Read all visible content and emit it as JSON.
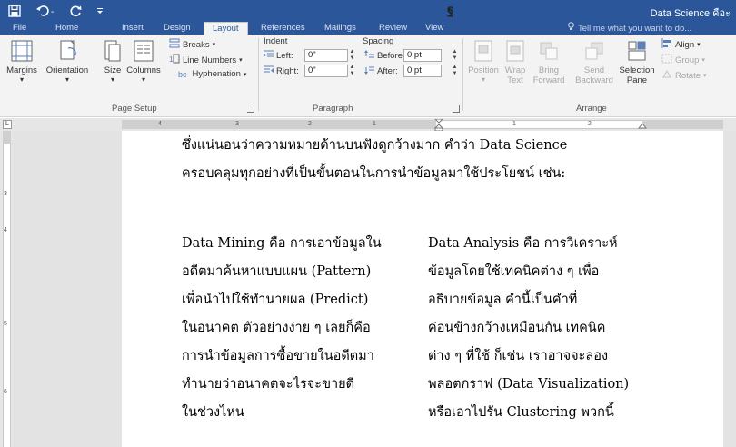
{
  "titlebar": {
    "doc_title": "Data Science คือะ",
    "title_mark": "ฐ"
  },
  "tabs": [
    {
      "label": "File"
    },
    {
      "label": "Home"
    },
    {
      "label": "Insert"
    },
    {
      "label": "Design"
    },
    {
      "label": "Layout"
    },
    {
      "label": "References"
    },
    {
      "label": "Mailings"
    },
    {
      "label": "Review"
    },
    {
      "label": "View"
    }
  ],
  "tell_me": "Tell me what you want to do...",
  "ribbon": {
    "page_setup": {
      "margins": "Margins",
      "orientation": "Orientation",
      "size": "Size",
      "columns": "Columns",
      "breaks": "Breaks",
      "line_numbers": "Line Numbers",
      "hyphenation": "Hyphenation",
      "group_label": "Page Setup"
    },
    "paragraph": {
      "indent_label": "Indent",
      "spacing_label": "Spacing",
      "left_label": "Left:",
      "left_value": "0\"",
      "right_label": "Right:",
      "right_value": "0\"",
      "before_label": "Before:",
      "before_value": "0 pt",
      "after_label": "After:",
      "after_value": "0 pt",
      "group_label": "Paragraph"
    },
    "arrange": {
      "position": "Position",
      "wrap_text_1": "Wrap",
      "wrap_text_2": "Text",
      "bring_forward_1": "Bring",
      "bring_forward_2": "Forward",
      "send_backward_1": "Send",
      "send_backward_2": "Backward",
      "selection_pane_1": "Selection",
      "selection_pane_2": "Pane",
      "align": "Align",
      "group": "Group",
      "rotate": "Rotate",
      "group_label": "Arrange"
    }
  },
  "ruler": {
    "ticks": [
      "4",
      "3",
      "2",
      "1",
      "1",
      "2"
    ],
    "vticks": [
      "3",
      "4",
      "5",
      "6"
    ]
  },
  "document": {
    "intro_line_1": "ซึ่งแน่นอนว่าความหมายด้านบนฟังดูกว้างมาก คำว่า Data Science",
    "intro_line_2": "ครอบคลุมทุกอย่างที่เป็นขั้นตอนในการนำข้อมูลมาใช้ประโยชน์ เช่น:",
    "left_column": [
      "Data Mining คือ การเอาข้อมูลใน",
      "อดีตมาค้นหาแบบแผน (Pattern)",
      "เพื่อนำไปใช้ทำนายผล (Predict)",
      "ในอนาคต ตัวอย่างง่าย ๆ เลยก็คือ",
      "การนำข้อมูลการซื้อขายในอดีตมา",
      "ทำนายว่าอนาคตจะไรจะขายดี",
      "ในช่วงไหน"
    ],
    "right_column": [
      "Data Analysis คือ การวิเคราะห์",
      "ข้อมูลโดยใช้เทคนิคต่าง ๆ เพื่อ",
      "อธิบายข้อมูล คำนี้เป็นคำที่",
      "ค่อนข้างกว้างเหมือนกัน เทคนิค",
      "ต่าง ๆ ที่ใช้ ก็เช่น เราอาจจะลอง",
      "พลอตกราฟ (Data Visualization)",
      "หรือเอาไปรัน Clustering พวกนี้"
    ]
  }
}
